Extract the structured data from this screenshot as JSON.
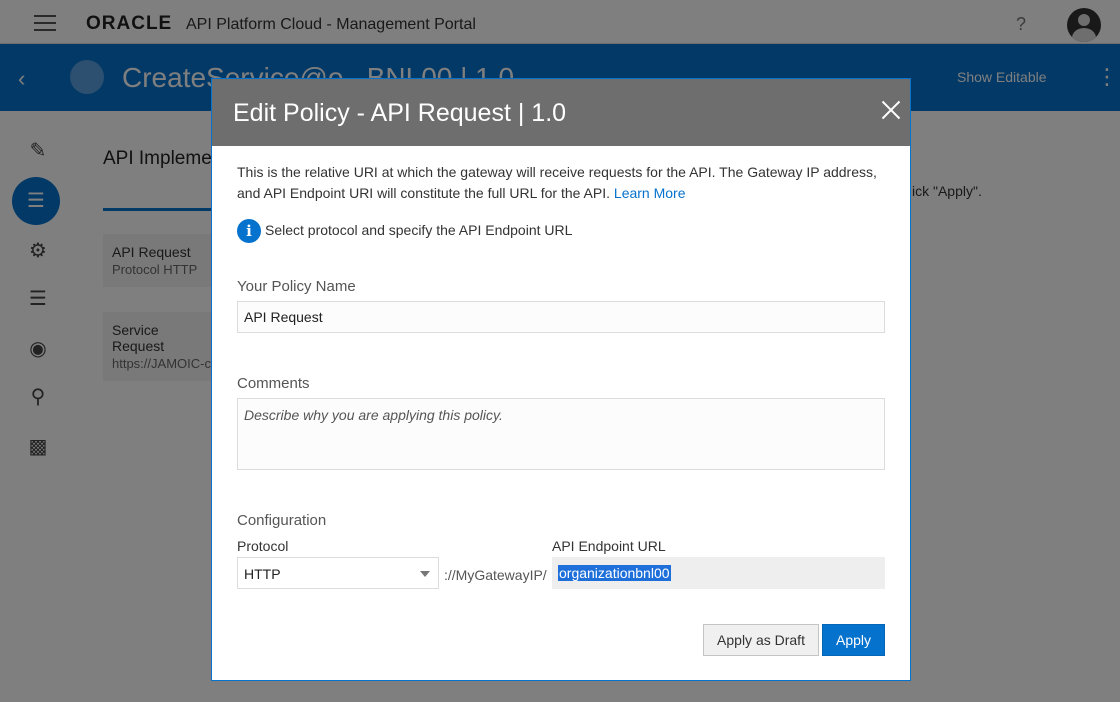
{
  "topbar": {
    "logo": "ORACLE",
    "title": "API Platform Cloud - Management Portal",
    "help_icon": "?"
  },
  "titlebar": {
    "service_title": "CreateService@o...BNL00 | 1.0",
    "show_editable": "Show Editable"
  },
  "background": {
    "section_title": "API Impleme",
    "hint": "ick \"Apply\".",
    "cards": [
      {
        "title": "API Request",
        "subtitle": "Protocol  HTTP"
      },
      {
        "title": "Service Request",
        "subtitle": "https://JAMOIC-c"
      }
    ]
  },
  "modal": {
    "title": "Edit Policy - API Request | 1.0",
    "description": "This is the relative URI at which the gateway will receive requests for the API. The Gateway IP address, and API Endpoint URI will constitute the full URL for the API.",
    "learn_more": "Learn More",
    "info_text": "Select protocol and specify the API Endpoint URL",
    "policy_name_label": "Your Policy Name",
    "policy_name_value": "API Request",
    "comments_label": "Comments",
    "comments_placeholder": "Describe why you are applying this policy.",
    "configuration_label": "Configuration",
    "protocol_label": "Protocol",
    "protocol_value": "HTTP",
    "gateway_prefix": "://MyGatewayIP/",
    "endpoint_label": "API Endpoint URL",
    "endpoint_value": "organizationbnl00",
    "apply_draft_label": "Apply as Draft",
    "apply_label": "Apply"
  },
  "colors": {
    "accent": "#0572ce",
    "modal_header": "#6e6e6e"
  }
}
